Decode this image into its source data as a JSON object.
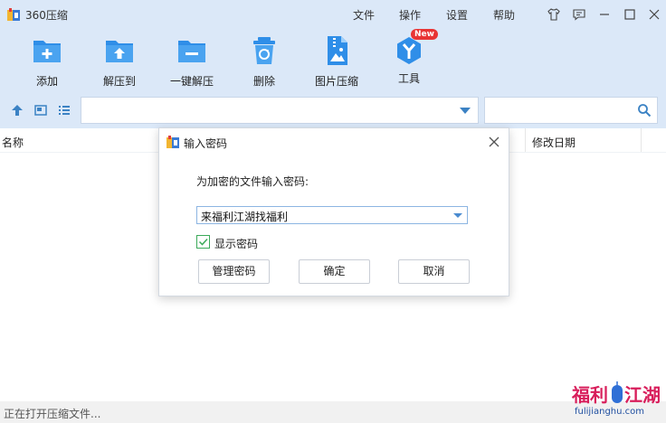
{
  "app": {
    "title": "360压缩"
  },
  "menu": {
    "file": "文件",
    "actions": "操作",
    "settings": "设置",
    "help": "帮助"
  },
  "toolbar": {
    "items": [
      {
        "label": "添加",
        "icon": "add-folder-icon"
      },
      {
        "label": "解压到",
        "icon": "extract-to-icon"
      },
      {
        "label": "一键解压",
        "icon": "one-click-extract-icon"
      },
      {
        "label": "删除",
        "icon": "delete-icon"
      },
      {
        "label": "图片压缩",
        "icon": "image-compress-icon"
      },
      {
        "label": "工具",
        "icon": "tools-icon",
        "badge": "New"
      }
    ]
  },
  "address": {
    "path": "",
    "search": ""
  },
  "filelist": {
    "columns": {
      "name": "名称",
      "modified": "修改日期"
    }
  },
  "status": {
    "text": "正在打开压缩文件..."
  },
  "dialog": {
    "title": "输入密码",
    "prompt": "为加密的文件输入密码:",
    "password_value": "来福利江湖找福利",
    "show_password_label": "显示密码",
    "show_password_checked": true,
    "buttons": {
      "manage": "管理密码",
      "ok": "确定",
      "cancel": "取消"
    }
  },
  "watermark": {
    "logo_text": "福利江湖",
    "url": "fulijianghu.com"
  },
  "colors": {
    "accent": "#2f8ee8",
    "chrome": "#dbe8f8",
    "badge": "#e83434",
    "check": "#3caa5a"
  }
}
